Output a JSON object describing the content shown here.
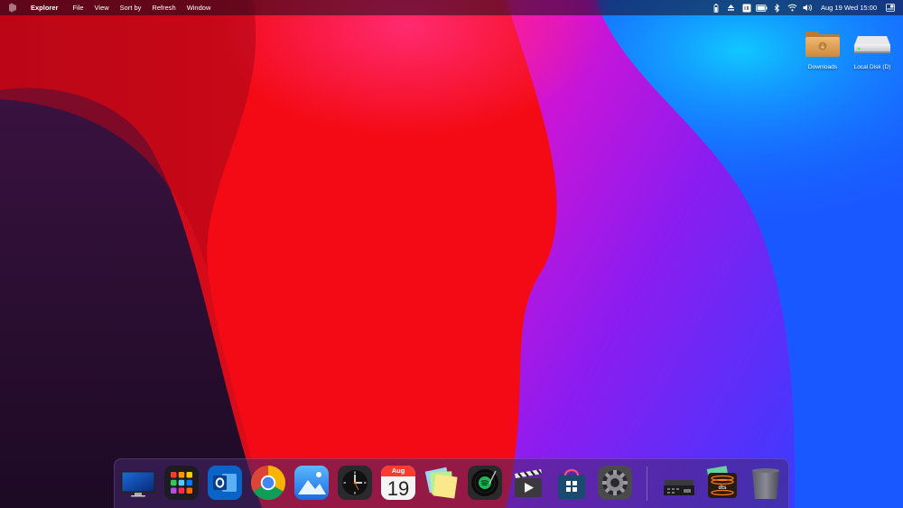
{
  "menubar": {
    "app_name": "Explorer",
    "menus": [
      "File",
      "View",
      "Sort by",
      "Refresh",
      "Window"
    ],
    "tray_icons": [
      "battery-vertical-icon",
      "eject-icon",
      "keyboard-layout-icon",
      "battery-icon",
      "bluetooth-icon",
      "wifi-icon",
      "volume-icon"
    ],
    "clock": "Aug 19 Wed 15:00",
    "notification_icon": "notification-center-icon"
  },
  "desktop": {
    "icons": [
      {
        "label": "Downloads",
        "icon": "downloads-folder-icon"
      },
      {
        "label": "Local Disk (D)",
        "icon": "local-disk-icon"
      }
    ]
  },
  "dock": {
    "items": [
      {
        "name": "desktop-monitor",
        "icon": "monitor-icon"
      },
      {
        "name": "launchpad",
        "icon": "app-grid-icon"
      },
      {
        "name": "outlook",
        "icon": "outlook-icon"
      },
      {
        "name": "chrome",
        "icon": "chrome-icon"
      },
      {
        "name": "photos",
        "icon": "photos-icon"
      },
      {
        "name": "clock",
        "icon": "clock-icon"
      },
      {
        "name": "calendar",
        "icon": "calendar-icon"
      },
      {
        "name": "sticky-notes",
        "icon": "sticky-notes-icon"
      },
      {
        "name": "spotify",
        "icon": "spotify-icon"
      },
      {
        "name": "video-editor",
        "icon": "clapperboard-icon"
      },
      {
        "name": "store",
        "icon": "store-bag-icon"
      },
      {
        "name": "settings",
        "icon": "settings-gear-icon"
      },
      {
        "name": "device-manager",
        "icon": "hardware-device-icon"
      },
      {
        "name": "dts-audio",
        "icon": "dts-audio-icon"
      },
      {
        "name": "trash",
        "icon": "trash-icon"
      }
    ],
    "calendar": {
      "month": "Aug",
      "day": "19"
    }
  },
  "colors": {
    "wallpaper_red": "#f40812",
    "wallpaper_magenta": "#e012c8",
    "wallpaper_purple": "#8a1cf0",
    "wallpaper_blue": "#1560ff",
    "wallpaper_dark": "#2a1238"
  }
}
